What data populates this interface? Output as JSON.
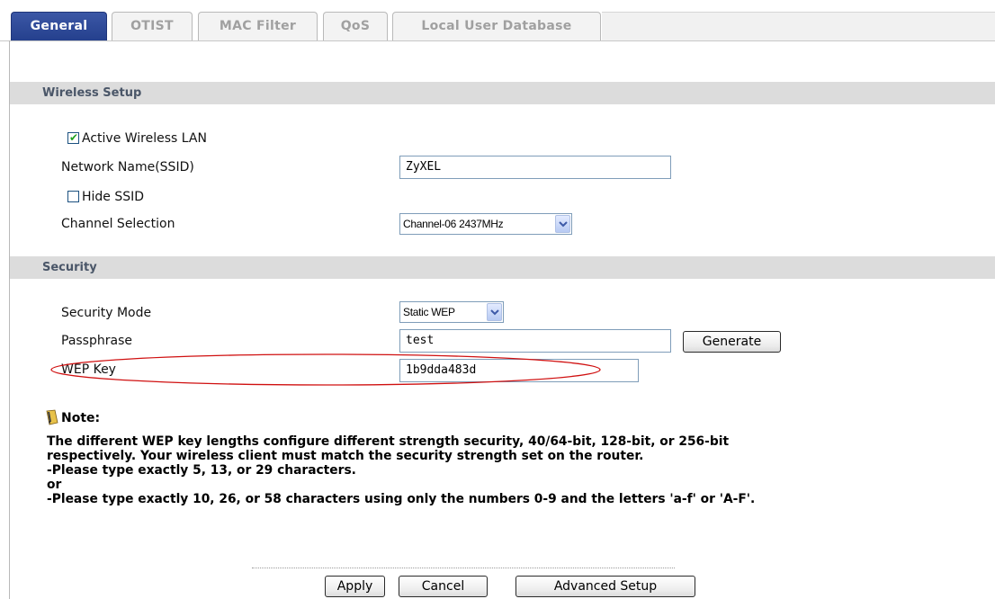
{
  "tabs": [
    {
      "label": "General",
      "active": true
    },
    {
      "label": "OTIST",
      "active": false
    },
    {
      "label": "MAC Filter",
      "active": false
    },
    {
      "label": "QoS",
      "active": false
    },
    {
      "label": "Local User Database",
      "active": false
    }
  ],
  "wireless_setup": {
    "header": "Wireless Setup",
    "active_wlan": {
      "label": "Active Wireless LAN",
      "checked": true
    },
    "ssid": {
      "label": "Network Name(SSID)",
      "value": "ZyXEL"
    },
    "hide_ssid": {
      "label": "Hide SSID",
      "checked": false
    },
    "channel": {
      "label": "Channel Selection",
      "value": "Channel-06 2437MHz"
    }
  },
  "security": {
    "header": "Security",
    "mode": {
      "label": "Security Mode",
      "value": "Static WEP"
    },
    "passphrase": {
      "label": "Passphrase",
      "value": "test",
      "button": "Generate"
    },
    "wep_key": {
      "label": "WEP Key",
      "value": "1b9dda483d"
    }
  },
  "note": {
    "title": "Note:",
    "lines": [
      "The different WEP key lengths configure different strength security, 40/64-bit, 128-bit, or 256-bit",
      "respectively. Your wireless client must match the security strength set on the router.",
      "-Please type exactly 5, 13, or 29 characters.",
      "or",
      "-Please type exactly 10, 26, or 58 characters using only the numbers 0-9 and the letters 'a-f' or 'A-F'."
    ]
  },
  "actions": {
    "apply": "Apply",
    "cancel": "Cancel",
    "advanced": "Advanced Setup"
  },
  "colors": {
    "active_tab": "#2c4794",
    "section_header_bg": "#dcdcdc",
    "highlight_ellipse": "#d01010"
  },
  "icons": {
    "note": "note-pencil-icon",
    "checkmark": "checkmark-icon",
    "dropdown": "chevron-down-icon"
  }
}
